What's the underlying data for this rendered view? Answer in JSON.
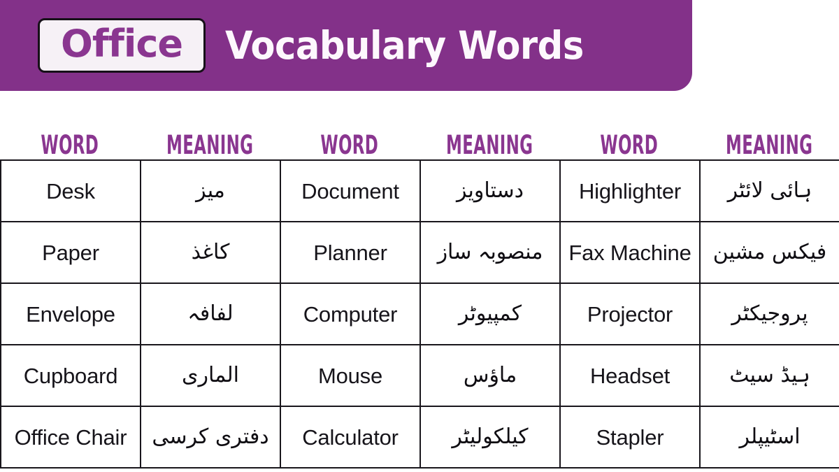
{
  "banner": {
    "topic_chip": "Office",
    "title": "Vocabulary Words",
    "background_color": "#833189",
    "chip_background_color": "#f6f1f6",
    "chip_text_color": "#8a3690",
    "title_text_color": "#fdf8fd"
  },
  "table": {
    "header_text_color": "#8a3690",
    "border_color": "#19161c",
    "columns": [
      {
        "label": "WORD"
      },
      {
        "label": "MEANING"
      },
      {
        "label": "WORD"
      },
      {
        "label": "MEANING"
      },
      {
        "label": "WORD"
      },
      {
        "label": "MEANING"
      }
    ],
    "rows": [
      {
        "c0": "Desk",
        "c1": "میز",
        "c2": "Document",
        "c3": "دستاویز",
        "c4": "Highlighter",
        "c5": "ہائی لائٹر"
      },
      {
        "c0": "Paper",
        "c1": "کاغذ",
        "c2": "Planner",
        "c3": "منصوبہ ساز",
        "c4": "Fax Machine",
        "c5": "فیکس مشین"
      },
      {
        "c0": "Envelope",
        "c1": "لفافہ",
        "c2": "Computer",
        "c3": "کمپیوٹر",
        "c4": "Projector",
        "c5": "پروجیکٹر"
      },
      {
        "c0": "Cupboard",
        "c1": "الماری",
        "c2": "Mouse",
        "c3": "ماؤس",
        "c4": "Headset",
        "c5": "ہیڈ سیٹ"
      },
      {
        "c0": "Office Chair",
        "c1": "دفتری کرسی",
        "c2": "Calculator",
        "c3": "کیلکولیٹر",
        "c4": "Stapler",
        "c5": "اسٹیپلر"
      }
    ]
  }
}
